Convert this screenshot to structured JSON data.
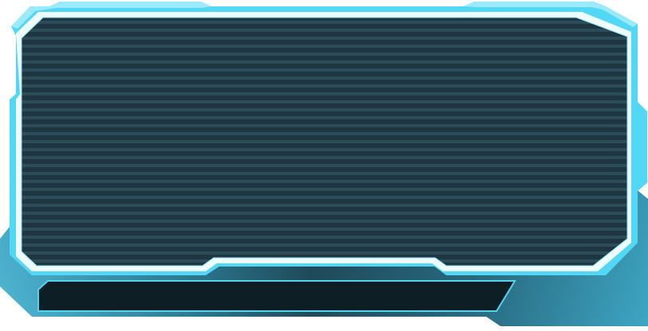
{
  "hud_frame": {
    "colors": {
      "frame_cyan": "#52D8F4",
      "frame_light": "#9BEAFB",
      "inner_border": "#EEFBFF",
      "screen_fill": "#1E3640",
      "scanline": "#2B4C58",
      "lower_panel_light": "#4FB8D6",
      "lower_panel_dark": "#23566A",
      "bar_fill": "#0D1F25",
      "bar_border": "#55D2EE"
    }
  },
  "display_screen": {
    "text": ""
  },
  "input_bar": {
    "text": ""
  }
}
